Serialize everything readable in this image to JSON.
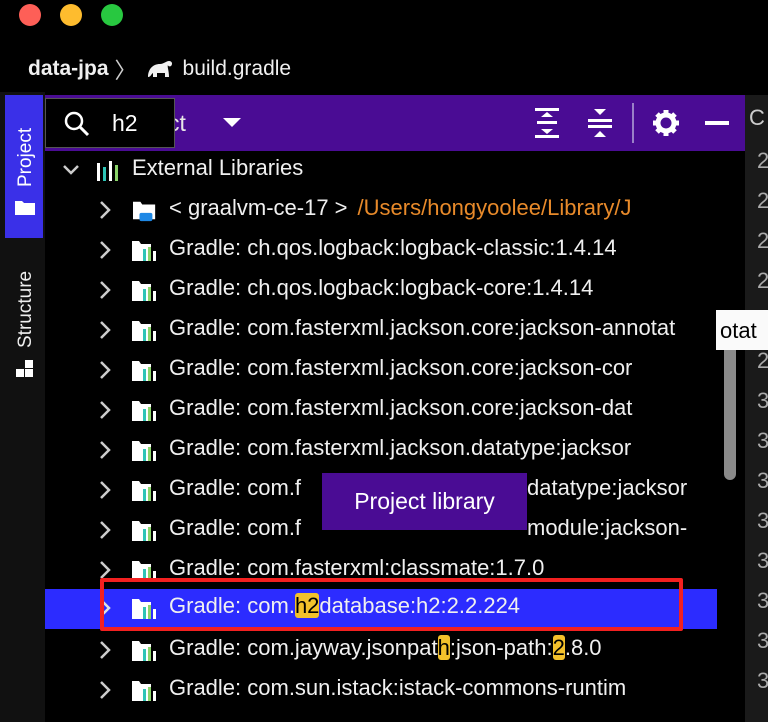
{
  "breadcrumb": {
    "project": "data-jpa",
    "file": "build.gradle"
  },
  "stripe": {
    "project_label": "Project",
    "structure_label": "Structure"
  },
  "search": {
    "query": "h2"
  },
  "panel": {
    "title_fragment": "ct"
  },
  "tree": {
    "root": {
      "label": "External Libraries"
    },
    "items": [
      {
        "label": "< graalvm-ce-17 >",
        "path": "/Users/hongyoolee/Library/J"
      },
      {
        "label": "Gradle: ch.qos.logback:logback-classic:1.4.14"
      },
      {
        "label": "Gradle: ch.qos.logback:logback-core:1.4.14"
      },
      {
        "label": "Gradle: com.fasterxml.jackson.core:jackson-annotat"
      },
      {
        "label": "Gradle: com.fasterxml.jackson.core:jackson-cor"
      },
      {
        "label": "Gradle: com.fasterxml.jackson.core:jackson-dat"
      },
      {
        "label": "Gradle: com.fasterxml.jackson.datatype:jacksor"
      },
      {
        "label_a": "Gradle: com.f",
        "label_b": "datatype:jacksor"
      },
      {
        "label_a": "Gradle: com.f",
        "label_b": "module:jackson-"
      },
      {
        "label": "Gradle: com.fasterxml:classmate:1.7.0"
      },
      {
        "pre": "Gradle: com.",
        "hl": "h2",
        "post": "database:h2:2.2.224"
      },
      {
        "pre": "Gradle: com.jayway.jsonpat",
        "hl": "h",
        "mid": ":json-path:",
        "hl2": "2",
        "post": ".8.0"
      },
      {
        "label": "Gradle: com.sun.istack:istack-commons-runtim"
      }
    ]
  },
  "tooltip": {
    "text": "Project library"
  },
  "edge_tooltip": {
    "text": "otat"
  },
  "gutter": [
    "2",
    "2",
    "2",
    "2",
    "2",
    "2",
    "3",
    "3",
    "3",
    "3",
    "3",
    "3",
    "3",
    "3"
  ]
}
